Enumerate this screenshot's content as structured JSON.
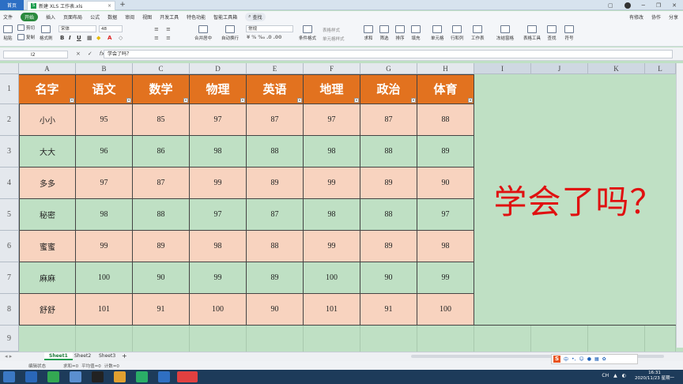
{
  "titlebar": {
    "home_label": "首页",
    "doc_title": "新建 XLS 工作表.xls",
    "doc_icon": "S",
    "close_glyph": "×",
    "new_tab_glyph": "+"
  },
  "menubar": {
    "items": [
      "文件",
      "开始",
      "插入",
      "页面布局",
      "公式",
      "数据",
      "审阅",
      "视图",
      "开发工具",
      "特色功能",
      "智能工具箱",
      "查找"
    ],
    "right_items": [
      "有修改",
      "协作",
      "分享"
    ]
  },
  "ribbon": {
    "clipboard": [
      "粘贴",
      "剪切",
      "复制",
      "格式刷"
    ],
    "font_name": "宋体",
    "font_size": "48",
    "format_buttons": [
      "B",
      "I",
      "U"
    ],
    "align": [
      "合并居中",
      "自动换行"
    ],
    "number_format": "常规",
    "style_buttons": [
      "条件格式",
      "表格样式",
      "单元格样式"
    ],
    "edit_buttons": [
      "求和",
      "筛选",
      "排序",
      "填充",
      "单元格",
      "行和列",
      "工作表",
      "冻结窗格",
      "表格工具",
      "查找",
      "符号"
    ]
  },
  "formula_bar": {
    "cell_ref": "I2",
    "fx_icons": [
      "×",
      "✓",
      "fx"
    ],
    "content": "学会了吗？"
  },
  "grid": {
    "columns": [
      "A",
      "B",
      "C",
      "D",
      "E",
      "F",
      "G",
      "H",
      "I",
      "J",
      "K",
      "L"
    ],
    "rows": [
      "1",
      "2",
      "3",
      "4",
      "5",
      "6",
      "7",
      "8",
      "9"
    ],
    "header": [
      "名字",
      "语文",
      "数学",
      "物理",
      "英语",
      "地理",
      "政治",
      "体育"
    ],
    "data": [
      [
        "小小",
        "95",
        "85",
        "97",
        "87",
        "97",
        "87",
        "88"
      ],
      [
        "大大",
        "96",
        "86",
        "98",
        "88",
        "98",
        "88",
        "89"
      ],
      [
        "多多",
        "97",
        "87",
        "99",
        "89",
        "99",
        "89",
        "90"
      ],
      [
        "秘密",
        "98",
        "88",
        "97",
        "87",
        "98",
        "88",
        "97"
      ],
      [
        "蜜蜜",
        "99",
        "89",
        "98",
        "88",
        "99",
        "89",
        "98"
      ],
      [
        "麻麻",
        "100",
        "90",
        "99",
        "89",
        "100",
        "90",
        "99"
      ],
      [
        "舒舒",
        "101",
        "91",
        "100",
        "90",
        "101",
        "91",
        "100"
      ]
    ],
    "merged_text": "学会了吗？",
    "colors": {
      "header_bg": "#e2721f",
      "peach_row": "#f8d3bf",
      "green_row": "#bfe0c4",
      "merged_text": "#e01010"
    }
  },
  "sheets": [
    "Sheet1",
    "Sheet2",
    "Sheet3"
  ],
  "statusbar": {
    "mode": "编辑状态",
    "sum": "求和=0",
    "avg": "平均值=0",
    "count": "计数=0"
  },
  "taskbar": {
    "clock_time": "16:31",
    "clock_date": "2020/11/23 星期一",
    "tray_text": "CH"
  },
  "ime": {
    "logo": "S",
    "label": "中"
  }
}
